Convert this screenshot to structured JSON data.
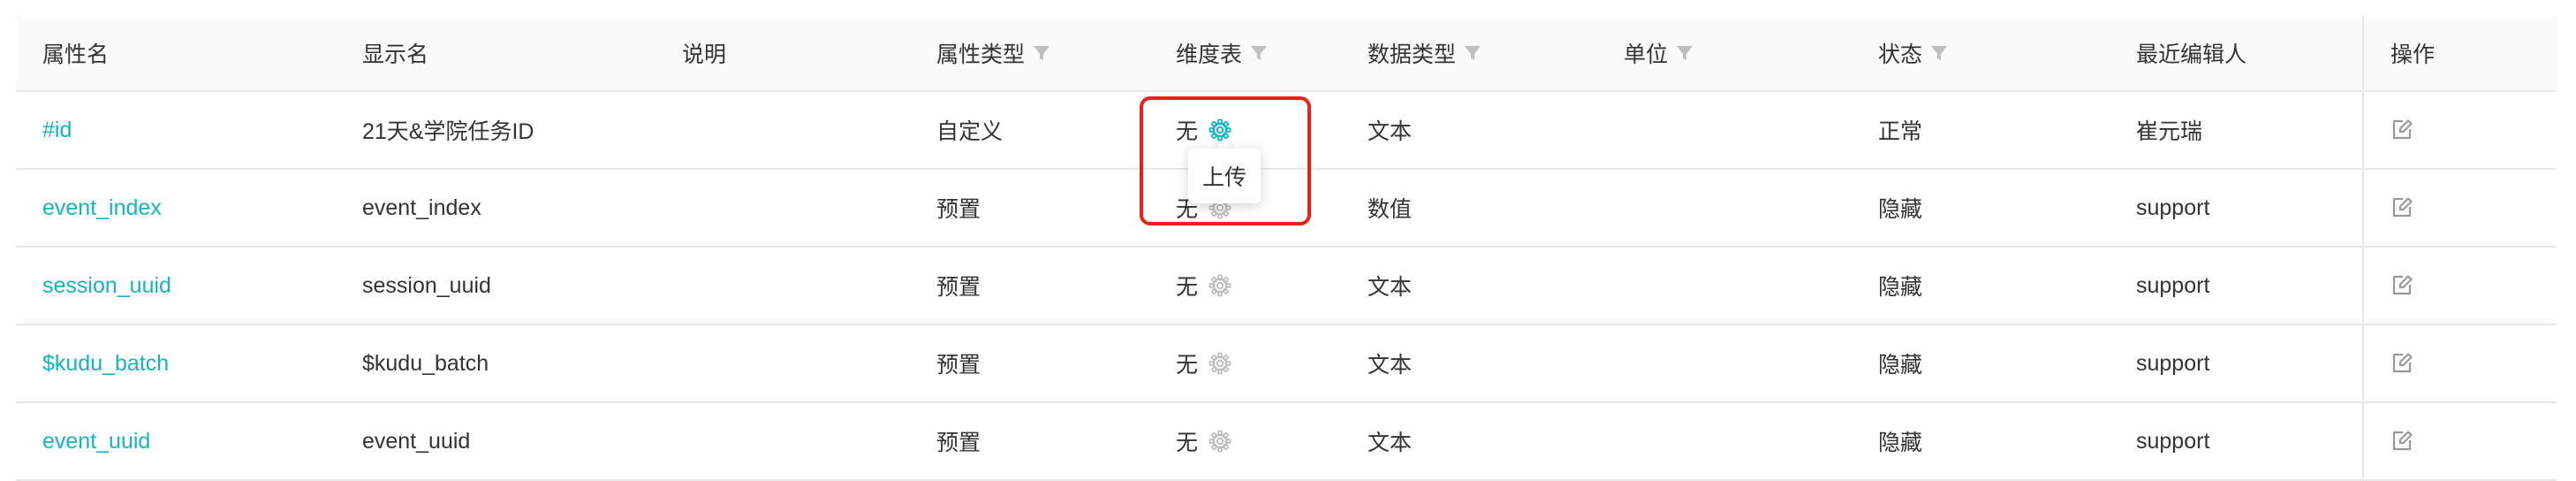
{
  "columns": [
    {
      "label": "属性名",
      "filter": false
    },
    {
      "label": "显示名",
      "filter": false
    },
    {
      "label": "说明",
      "filter": false
    },
    {
      "label": "属性类型",
      "filter": true
    },
    {
      "label": "维度表",
      "filter": true
    },
    {
      "label": "数据类型",
      "filter": true
    },
    {
      "label": "单位",
      "filter": true
    },
    {
      "label": "状态",
      "filter": true
    },
    {
      "label": "最近编辑人",
      "filter": false
    },
    {
      "label": "操作",
      "filter": false
    }
  ],
  "rows": [
    {
      "name": "#id",
      "display": "21天&学院任务ID",
      "desc": "",
      "prop_type": "自定义",
      "dim": "无",
      "data_type": "文本",
      "unit": "",
      "status": "正常",
      "editor": "崔元瑞",
      "gear_active": true
    },
    {
      "name": "event_index",
      "display": "event_index",
      "desc": "",
      "prop_type": "预置",
      "dim": "无",
      "data_type": "数值",
      "unit": "",
      "status": "隐藏",
      "editor": "support",
      "gear_active": false
    },
    {
      "name": "session_uuid",
      "display": "session_uuid",
      "desc": "",
      "prop_type": "预置",
      "dim": "无",
      "data_type": "文本",
      "unit": "",
      "status": "隐藏",
      "editor": "support",
      "gear_active": false
    },
    {
      "name": "$kudu_batch",
      "display": "$kudu_batch",
      "desc": "",
      "prop_type": "预置",
      "dim": "无",
      "data_type": "文本",
      "unit": "",
      "status": "隐藏",
      "editor": "support",
      "gear_active": false
    },
    {
      "name": "event_uuid",
      "display": "event_uuid",
      "desc": "",
      "prop_type": "预置",
      "dim": "无",
      "data_type": "文本",
      "unit": "",
      "status": "隐藏",
      "editor": "support",
      "gear_active": false
    }
  ],
  "tooltip": {
    "text": "上传"
  },
  "colors": {
    "link": "#13b5c1",
    "gear_active": "#13b5c1",
    "gear_inactive": "#bfbfbf",
    "highlight": "#e8231b",
    "icon": "#999999"
  },
  "icons": {
    "filter": "filter-icon",
    "gear": "gear-icon",
    "edit": "edit-icon"
  }
}
